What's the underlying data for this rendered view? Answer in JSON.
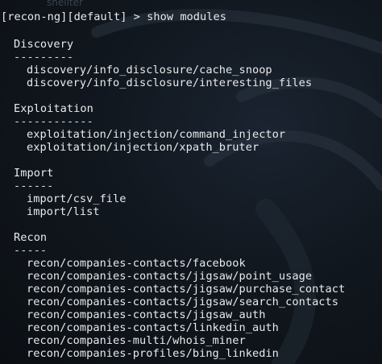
{
  "terminal": {
    "background_ghost_text": "shellter",
    "prompt": "[recon-ng][default] > show modules",
    "colors": {
      "background": "#0d1116",
      "text": "#e8eaec"
    },
    "sections": [
      {
        "title": "Discovery",
        "underline": "---------",
        "modules": [
          "discovery/info_disclosure/cache_snoop",
          "discovery/info_disclosure/interesting_files"
        ]
      },
      {
        "title": "Exploitation",
        "underline": "------------",
        "modules": [
          "exploitation/injection/command_injector",
          "exploitation/injection/xpath_bruter"
        ]
      },
      {
        "title": "Import",
        "underline": "------",
        "modules": [
          "import/csv_file",
          "import/list"
        ]
      },
      {
        "title": "Recon",
        "underline": "-----",
        "modules": [
          "recon/companies-contacts/facebook",
          "recon/companies-contacts/jigsaw/point_usage",
          "recon/companies-contacts/jigsaw/purchase_contact",
          "recon/companies-contacts/jigsaw/search_contacts",
          "recon/companies-contacts/jigsaw_auth",
          "recon/companies-contacts/linkedin_auth",
          "recon/companies-multi/whois_miner",
          "recon/companies-profiles/bing_linkedin"
        ]
      }
    ]
  }
}
